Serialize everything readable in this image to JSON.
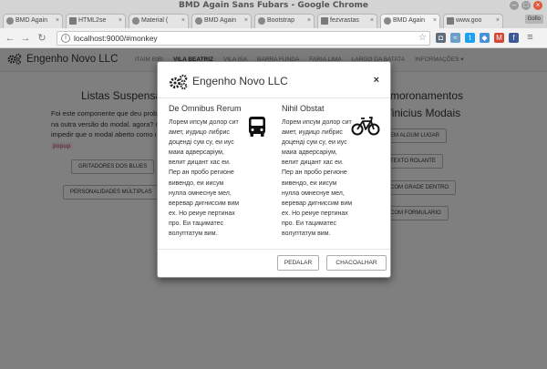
{
  "window": {
    "title": "BMD Again Sans Fubars - Google Chrome"
  },
  "tabs": [
    {
      "label": "BMD Again"
    },
    {
      "label": "HTML2se"
    },
    {
      "label": "Material ("
    },
    {
      "label": "BMD Again"
    },
    {
      "label": "Bootstrap"
    },
    {
      "label": "fezvrastas"
    },
    {
      "label": "BMD Again"
    },
    {
      "label": "www.goo"
    }
  ],
  "guest_badge": "Gofio",
  "address_bar": {
    "url": "localhost:9000/#monkey"
  },
  "site": {
    "brand": "Engenho Novo LLC",
    "nav": [
      {
        "label": "ITAIM BIBI",
        "active": false
      },
      {
        "label": "VILA BEATRIZ",
        "active": true
      },
      {
        "label": "VILA ISA",
        "active": false
      },
      {
        "label": "BARRA FUNDA",
        "active": false
      },
      {
        "label": "FARIA LIMA",
        "active": false
      },
      {
        "label": "LARGO DA BATATA",
        "active": false
      },
      {
        "label": "INFORMAÇÕES ▾",
        "active": false
      }
    ]
  },
  "left_section": {
    "title": "Listas Suspensas",
    "text_before": "Foi este componente que deu problemas na outra versão do modal. agora? Como impedir que o modal aberto como um",
    "code_word": "popup",
    "buttons": [
      "GRITADORES DOS BLUES",
      "PERSONALIDADES MÚLTIPLAS"
    ]
  },
  "right_section": {
    "title_line1": "Amoronamentos",
    "title_line2": "Vinicius Modais",
    "buttons": [
      "EM ALGUM LUGAR",
      "TEXTO ROLANTE",
      "COM GRADE DENTRO",
      "COM FORMULARIO"
    ]
  },
  "modal": {
    "title": "Engenho Novo LLC",
    "close_label": "×",
    "left": {
      "heading": "De Omnibus Rerum",
      "body": "Лорем ипсум долор сит амет, иудицо либрис доцендi сум су, еи иус маиа адверсарiум, велит дицант хас еи. Пер ан пробо регионе вивендо, еи иисум нулла омнеснуе мел, веревар дигниссим вим ех. Но реиуе пертинах про. Еи тациматес волуптатум вим."
    },
    "right": {
      "heading": "Nihil Obstat",
      "body": "Лорем ипсум долор сит амет, иудицо либрис доцендi сум су, еи иус маиа адверсарiум, велит дицант хас еи. Пер ан пробо регионе вивендо, еи иисум нулла омнеснуе мел, веревар дигниссим вим ех. Но реиуе пертинах про. Еи тациматес волуптатум вим."
    },
    "buttons": {
      "primary": "PEDALAR",
      "secondary": "CHACOALHAR"
    }
  }
}
